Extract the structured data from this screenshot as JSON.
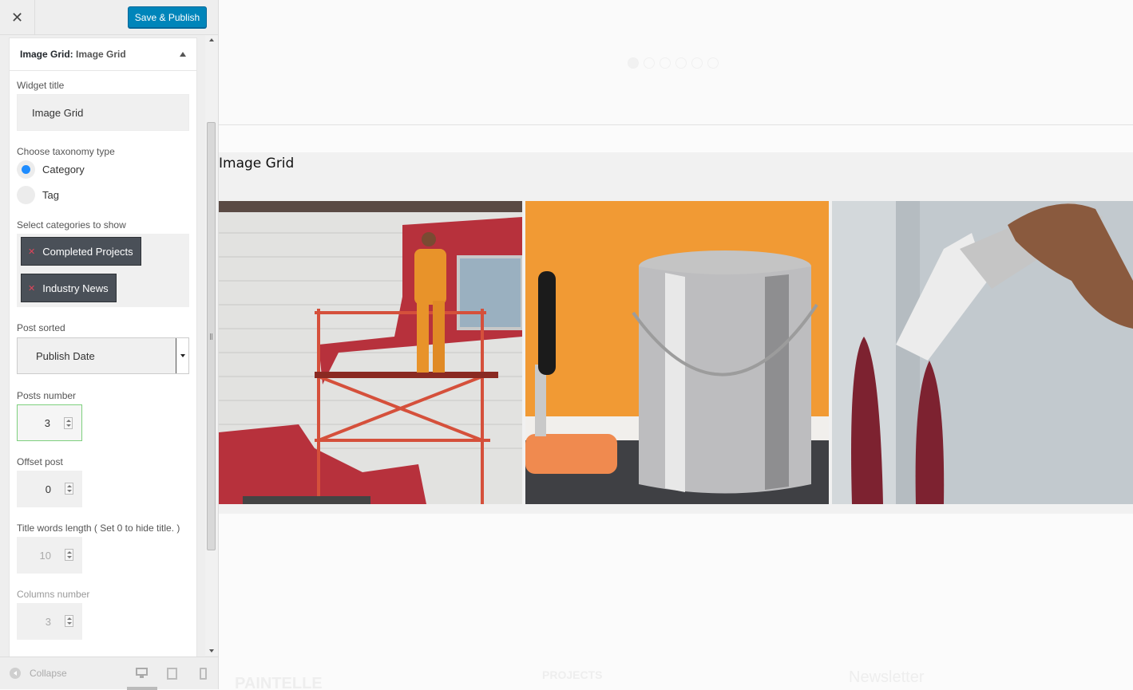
{
  "topbar": {
    "close_icon": "close-icon",
    "save_label": "Save & Publish"
  },
  "widget": {
    "header_type": "Image Grid:",
    "header_name": "Image Grid",
    "title_label": "Widget title",
    "title_value": "Image Grid",
    "taxonomy_label": "Choose taxonomy type",
    "taxonomy_options": [
      {
        "label": "Category",
        "selected": true
      },
      {
        "label": "Tag",
        "selected": false
      }
    ],
    "categories_label": "Select categories to show",
    "categories": [
      "Completed Projects",
      "Industry News"
    ],
    "sorted_label": "Post sorted",
    "sorted_value": "Publish Date",
    "posts_number_label": "Posts number",
    "posts_number": "3",
    "offset_label": "Offset post",
    "offset_value": "0",
    "title_words_label": "Title words length ( Set 0 to hide title. )",
    "title_words_value": "10",
    "columns_label": "Columns number",
    "columns_value": "3"
  },
  "footer": {
    "collapse_label": "Collapse"
  },
  "preview": {
    "section_title": "Image Grid",
    "images": [
      {
        "icon": "painter-on-scaffold-photo"
      },
      {
        "icon": "paint-can-and-roller-photo"
      },
      {
        "icon": "paintbrush-on-wall-photo"
      }
    ],
    "faded_brand": "PAINTELLE",
    "faded_projects": "PROJECTS",
    "faded_newsletter": "Newsletter"
  },
  "colors": {
    "accent": "#0085ba",
    "radio_on": "#1e8cff",
    "chip_bg": "#4a5058",
    "chip_x": "#e0455a"
  }
}
